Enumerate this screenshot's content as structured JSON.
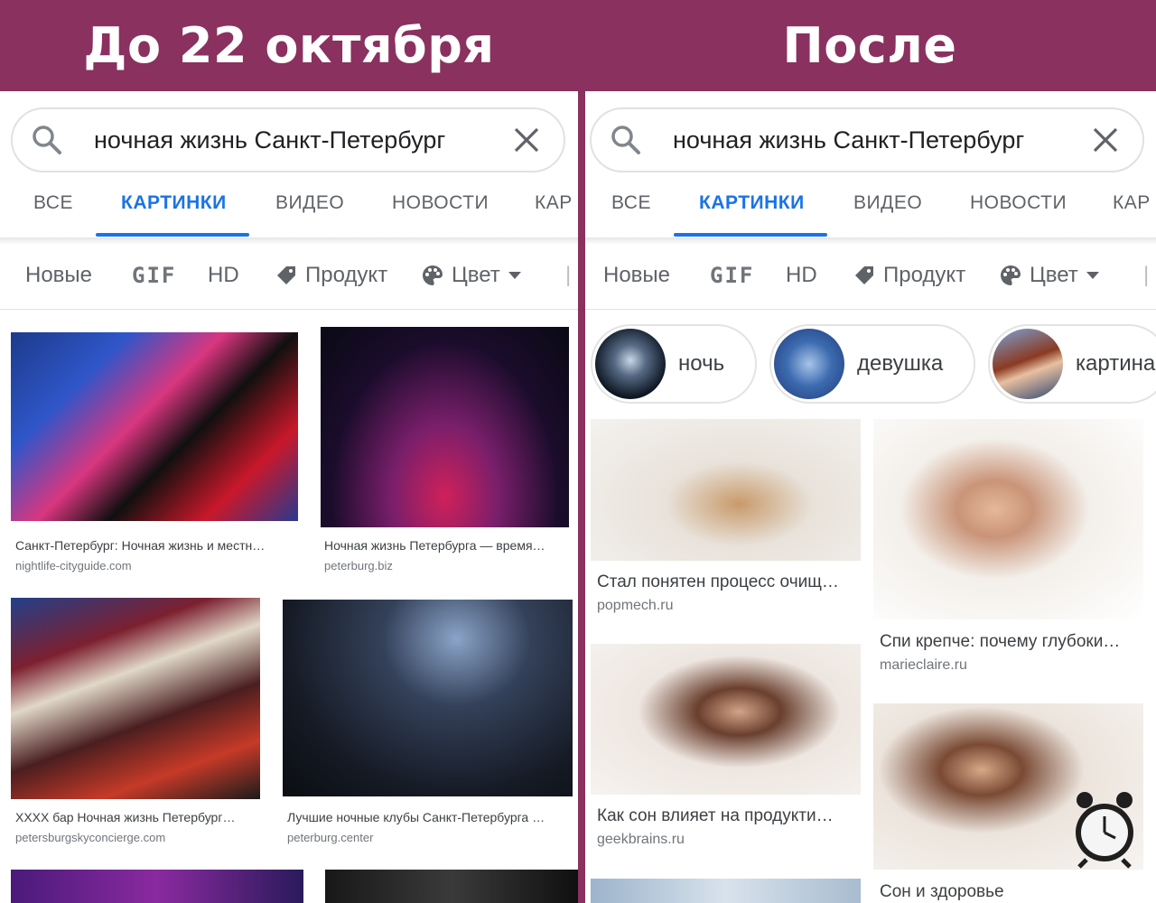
{
  "banner": {
    "before": "До 22 октября",
    "after": "После"
  },
  "search": {
    "query": "ночная жизнь Санкт-Петербург"
  },
  "tabs": [
    "ВСЕ",
    "КАРТИНКИ",
    "ВИДЕО",
    "НОВОСТИ",
    "КАР"
  ],
  "filters": {
    "new": "Новые",
    "gif": "GIF",
    "hd": "HD",
    "product": "Продукт",
    "color": "Цвет"
  },
  "chips": [
    "ночь",
    "девушка",
    "картина"
  ],
  "before_results": [
    {
      "title": "Санкт-Петербург: Ночная жизнь и местн…",
      "source": "nightlife-cityguide.com"
    },
    {
      "title": "Ночная жизнь Петербурга — время…",
      "source": "peterburg.biz"
    },
    {
      "title": "XXXX бар Ночная жизнь Петербург…",
      "source": "petersburgskyconcierge.com"
    },
    {
      "title": "Лучшие ночные клубы Санкт-Петербурга …",
      "source": "peterburg.center"
    }
  ],
  "after_results": [
    {
      "title": "Стал понятен процесс очищ…",
      "source": "popmech.ru"
    },
    {
      "title": "Спи крепче: почему глубоки…",
      "source": "marieclaire.ru"
    },
    {
      "title": "Как сон влияет на продукти…",
      "source": "geekbrains.ru"
    },
    {
      "title": "Сон и здоровье",
      "source": ""
    }
  ],
  "colors": {
    "banner": "#8a3160",
    "accent": "#1a73e8"
  }
}
